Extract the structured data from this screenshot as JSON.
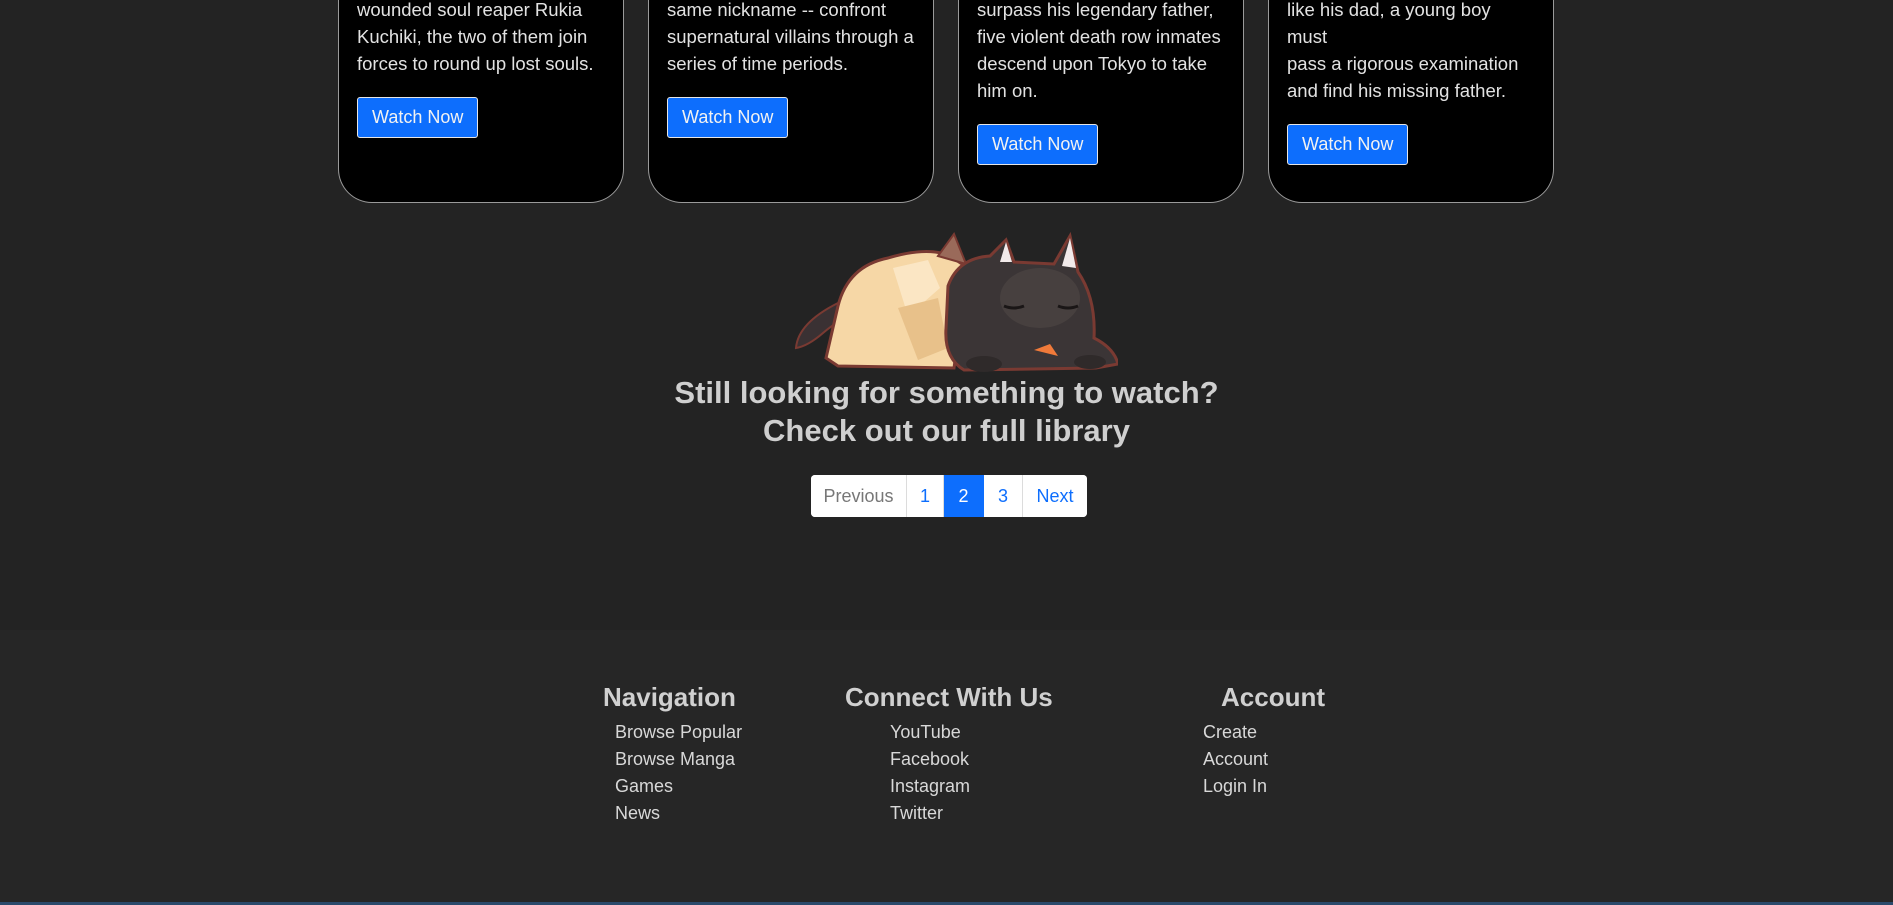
{
  "cards": [
    {
      "description_lines": [
        "wounded soul reaper Rukia",
        "Kuchiki, the two of them join",
        "forces to round up lost souls."
      ],
      "button_label": "Watch Now"
    },
    {
      "description_lines": [
        "same nickname -- confront",
        "supernatural villains through a",
        "series of time periods."
      ],
      "button_label": "Watch Now"
    },
    {
      "description_lines": [
        "surpass his legendary father,",
        "five violent death row inmates",
        "descend upon Tokyo to take",
        "him on."
      ],
      "button_label": "Watch Now"
    },
    {
      "description_lines": [
        "like his dad, a young boy must",
        "pass a rigorous examination",
        "and find his missing father."
      ],
      "button_label": "Watch Now"
    }
  ],
  "cta": {
    "line1": "Still looking for something to watch?",
    "line2": "Check out our full library"
  },
  "pagination": {
    "previous": "Previous",
    "pages": [
      "1",
      "2",
      "3"
    ],
    "active_page": "2",
    "next": "Next"
  },
  "footer": {
    "navigation": {
      "title": "Navigation",
      "items": [
        "Browse Popular",
        "Browse Manga",
        "Games",
        "News"
      ]
    },
    "connect": {
      "title": "Connect With Us",
      "items": [
        "YouTube",
        "Facebook",
        "Instagram",
        "Twitter"
      ]
    },
    "account": {
      "title": "Account",
      "items": [
        "Create Account",
        "Login In"
      ]
    }
  },
  "colors": {
    "accent": "#0d6efd",
    "background": "#232323",
    "footer_background": "#262626",
    "card_background": "#000000"
  }
}
